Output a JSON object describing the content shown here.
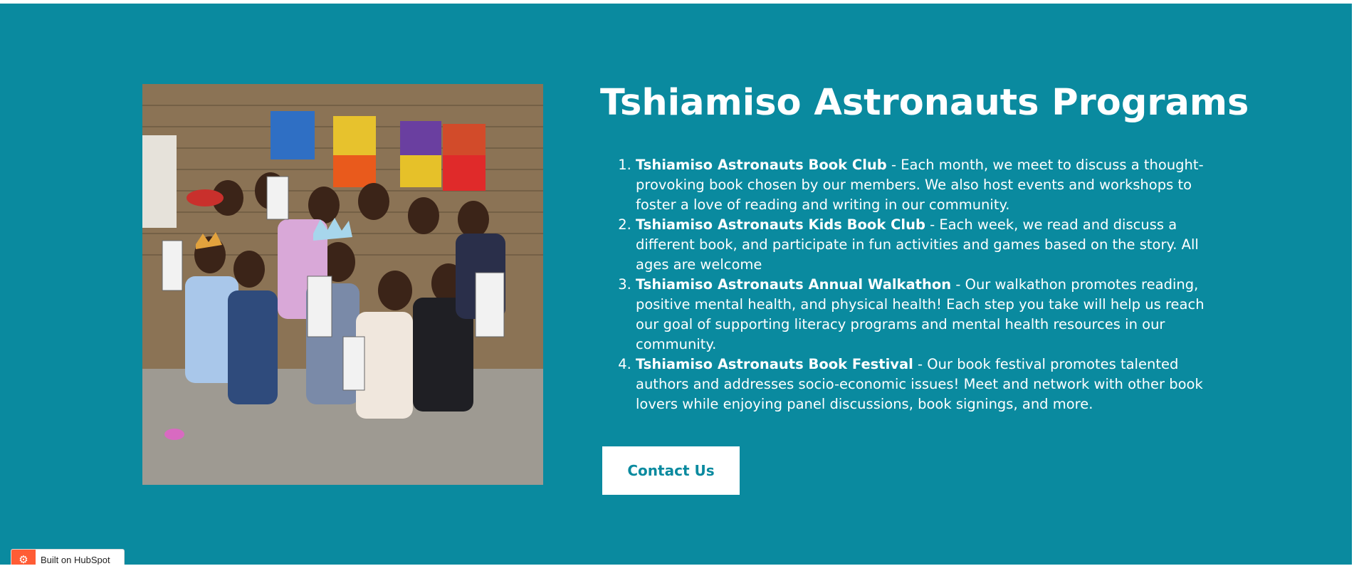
{
  "colors": {
    "section_bg": "#0a8a9f",
    "button_bg": "#ffffff",
    "button_text": "#0a8a9f",
    "hubspot_orange": "#ff5c35"
  },
  "section": {
    "title": "Tshiamiso Astronauts Programs",
    "image_icon": "photo-children-holding-bookmarks",
    "programs": [
      {
        "number": "1.",
        "name": "Tshiamiso Astronauts Book Club",
        "description": " - Each month, we meet to discuss a thought-provoking book chosen by our members. We also host events and workshops to foster a love of reading and writing in our community."
      },
      {
        "number": "2.",
        "name": "Tshiamiso Astronauts Kids Book Club",
        "description": " - Each week, we read and discuss a different book, and participate in fun activities and games based on the story. All ages are welcome"
      },
      {
        "number": "3.",
        "name": "Tshiamiso Astronauts Annual Walkathon",
        "description": " -  Our walkathon promotes reading, positive mental health, and physical health! Each step you take will help us reach our goal of supporting literacy programs and mental health resources in our community."
      },
      {
        "number": "4.",
        "name": "Tshiamiso Astronauts Book Festival",
        "description": " -  Our book festival promotes talented authors and addresses socio-economic issues! Meet and network with other book lovers while enjoying panel discussions, book signings, and more."
      }
    ],
    "contact_button": "Contact Us"
  },
  "hubspot_badge": {
    "label": "Built on HubSpot",
    "icon": "hubspot-sprocket-icon"
  }
}
